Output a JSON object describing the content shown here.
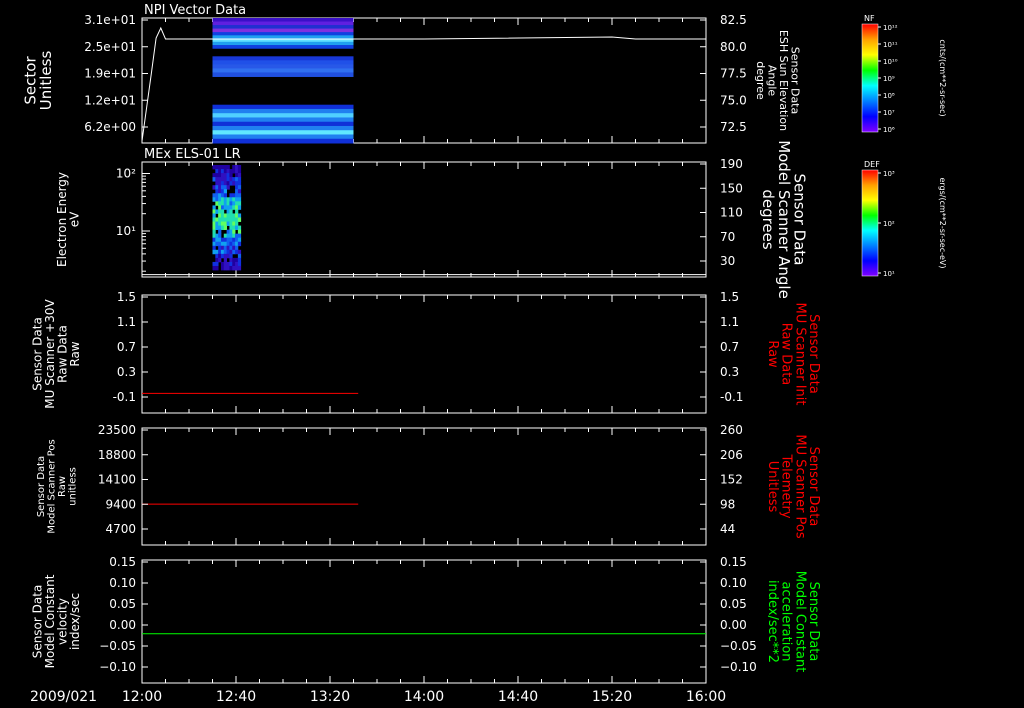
{
  "time_axis": {
    "date_label": "2009/021",
    "tick_labels": [
      "12:00",
      "12:40",
      "13:20",
      "14:00",
      "14:40",
      "15:20",
      "16:00"
    ],
    "start_minutes": 720,
    "end_minutes": 960
  },
  "colorbars": [
    {
      "title": "NF",
      "unit_label": "cnts/(cm**2-sr-sec)",
      "tick_labels": [
        "10¹²",
        "10¹¹",
        "10¹⁰",
        "10⁹",
        "10⁸",
        "10⁷",
        "10⁶"
      ],
      "palette": [
        "#ff0000",
        "#ffa000",
        "#ffff00",
        "#00ff00",
        "#00ffff",
        "#0080ff",
        "#0000ff",
        "#8000ff"
      ]
    },
    {
      "title": "DEF",
      "unit_label": "ergs/(cm**2-sr-sec-eV)",
      "tick_labels": [
        "10³",
        "10²",
        "10¹"
      ],
      "palette": [
        "#ff0000",
        "#ffa000",
        "#ffff00",
        "#00ff00",
        "#00ffff",
        "#0080ff",
        "#0000ff",
        "#8000ff"
      ]
    }
  ],
  "chart_data": [
    {
      "type": "heatmap",
      "title": "NPI Vector Data",
      "ylabel": "Sector\nUnitless",
      "y_tick_labels": [
        "3.1e+01",
        "2.5e+01",
        "1.9e+01",
        "1.2e+01",
        "6.2e+00"
      ],
      "ylim": [
        0,
        31
      ],
      "y2label": "Sensor Data\nESH Sun Elevation\nAngle\ndegree",
      "y2_tick_labels": [
        "82.5",
        "80.0",
        "77.5",
        "75.0",
        "72.5"
      ],
      "y2lim": [
        70,
        82.5
      ],
      "heatmap_time_range": [
        "12:30",
        "13:30"
      ],
      "sector_bands": [
        {
          "y0": 27.5,
          "y1": 31,
          "level": "mixed-purple-blue"
        },
        {
          "y0": 23.5,
          "y1": 27.5,
          "level": "cyan-blue"
        },
        {
          "y0": 19.5,
          "y1": 21.5,
          "level": "blue"
        },
        {
          "y0": 16.5,
          "y1": 19.5,
          "level": "blue-light"
        },
        {
          "y0": 0,
          "y1": 9.5,
          "level": "cyan-blue-striped"
        }
      ],
      "line_series": [
        {
          "color": "#ffffff",
          "x": [
            "12:00",
            "12:04",
            "12:06",
            "12:08",
            "12:10",
            "12:30",
            "13:30",
            "14:00",
            "15:20",
            "15:30",
            "16:00"
          ],
          "y": [
            70.2,
            77,
            80.5,
            81.5,
            80.4,
            80.4,
            80.4,
            80.4,
            80.6,
            80.4,
            80.4
          ]
        }
      ]
    },
    {
      "type": "heatmap",
      "title": "MEx ELS-01 LR",
      "ylabel": "Electron Energy\neV",
      "y_tick_labels": [
        "10²",
        "10¹"
      ],
      "ylim_log10": [
        0.2,
        2.2
      ],
      "y2label": "Sensor Data\nModel Scanner Angle\ndegrees",
      "y2_tick_labels": [
        "190",
        "150",
        "110",
        "70",
        "30"
      ],
      "y2lim": [
        0,
        190
      ],
      "heatmap_time_range": [
        "12:30",
        "12:42"
      ],
      "line_series": [
        {
          "color": "#ffffff",
          "x": [
            "12:00",
            "16:00"
          ],
          "y": [
            4,
            4
          ]
        }
      ]
    },
    {
      "type": "line",
      "ylabel": "Sensor Data\nMU Scanner +30V\nRaw Data\nRaw",
      "y_tick_labels": [
        "1.5",
        "1.1",
        "0.7",
        "0.3",
        "-0.1"
      ],
      "ylim": [
        -0.3,
        1.5
      ],
      "y2label": "Sensor Data\nMU Scanner Init\nRaw Data\nRaw",
      "y2_tick_labels": [
        "1.5",
        "1.1",
        "0.7",
        "0.3",
        "-0.1"
      ],
      "series": [
        {
          "color": "#ff0000",
          "x": [
            "12:00",
            "13:32"
          ],
          "y": [
            0,
            0
          ]
        }
      ]
    },
    {
      "type": "line",
      "ylabel": "Sensor Data\nModel Scanner Pos\nRaw\nunitless",
      "y_tick_labels": [
        "23500",
        "18800",
        "14100",
        "9400",
        "4700"
      ],
      "ylim": [
        0,
        23500
      ],
      "y2label": "Sensor Data\nMU Scanner Pos\nTelemetry\nUnitless",
      "y2_tick_labels": [
        "260",
        "206",
        "152",
        "98",
        "44"
      ],
      "series": [
        {
          "color": "#ff0000",
          "x": [
            "12:00",
            "13:32"
          ],
          "y": [
            8200,
            8200
          ]
        }
      ]
    },
    {
      "type": "line",
      "ylabel": "Sensor Data\nModel Constant\nvelocity\nindex/sec",
      "y_tick_labels": [
        "0.15",
        "0.10",
        "0.05",
        "0.00",
        "−0.05",
        "−0.10"
      ],
      "ylim": [
        -0.1,
        0.15
      ],
      "y2label": "Sensor Data\nModel Constant\nacceleration\nindex/sec**2",
      "y2_tick_labels": [
        "0.15",
        "0.10",
        "0.05",
        "0.00",
        "−0.05",
        "−0.10"
      ],
      "series": [
        {
          "color": "#00ff00",
          "x": [
            "12:00",
            "16:00"
          ],
          "y": [
            0,
            0
          ]
        }
      ]
    }
  ]
}
